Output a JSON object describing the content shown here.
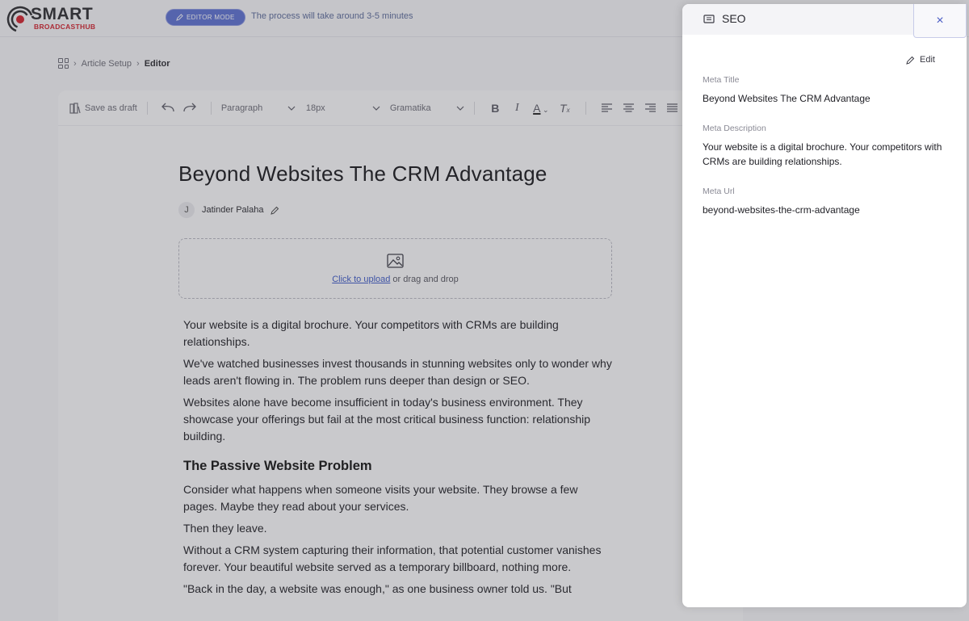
{
  "app": {
    "logo_word": "SMART",
    "logo_sub": "BROADCASTHUB",
    "mode_label": "EDITOR MODE",
    "process_text": "The process will take around 3-5 minutes"
  },
  "breadcrumb": {
    "items": [
      "Article Setup",
      "Editor"
    ]
  },
  "toolbar": {
    "save_draft": "Save as draft",
    "block_type": "Paragraph",
    "font_size": "18px",
    "grammar": "Gramatika"
  },
  "article": {
    "title": "Beyond Websites The CRM Advantage",
    "author_initial": "J",
    "author_name": "Jatinder Palaha",
    "upload_link": "Click to upload",
    "upload_rest": " or drag and drop",
    "paragraphs_intro": [
      "Your website is a digital brochure. Your competitors with CRMs are building relationships.",
      "We've watched businesses invest thousands in stunning websites only to wonder why leads aren't flowing in. The problem runs deeper than design or SEO.",
      "Websites alone have become insufficient in today's business environment. They showcase your offerings but fail at the most critical business function: relationship building."
    ],
    "heading": "The Passive Website Problem",
    "paragraphs_after": [
      "Consider what happens when someone visits your website. They browse a few pages. Maybe they read about your services.",
      "Then they leave.",
      "Without a CRM system capturing their information, that potential customer vanishes forever. Your beautiful website served as a temporary billboard, nothing more.",
      "\"Back in the day, a website was enough,\" as one business owner told us. \"But"
    ]
  },
  "seo_panel": {
    "title": "SEO",
    "close_symbol": "×",
    "edit_label": "Edit",
    "meta_title_label": "Meta Title",
    "meta_title_value": "Beyond Websites The CRM Advantage",
    "meta_description_label": "Meta Description",
    "meta_description_value": "Your website is a digital brochure. Your competitors with CRMs are building relationships.",
    "meta_url_label": "Meta Url",
    "meta_url_value": "beyond-websites-the-crm-advantage"
  },
  "colors": {
    "accent": "#5b6fd1",
    "link": "#3b58c7",
    "logo_red": "#d11f2b"
  }
}
